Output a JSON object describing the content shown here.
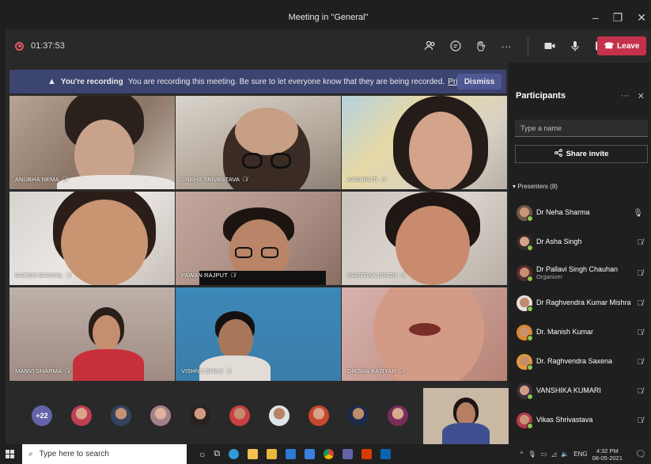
{
  "window": {
    "title": "Meeting in \"General\""
  },
  "toolbar": {
    "timer": "01:37:53",
    "leave_label": "Leave"
  },
  "banner": {
    "bold": "You're recording",
    "text": "You are recording this meeting. Be sure to let everyone know that they are being recorded.",
    "link": "Privacy policy",
    "dismiss": "Dismiss"
  },
  "tiles": [
    {
      "name": "ANUBHA NEMA"
    },
    {
      "name": "SNEHA SRIVASTAVA"
    },
    {
      "name": "AASHRUTI"
    },
    {
      "name": "SAKSHI BANSAL"
    },
    {
      "name": "PAWAN RAJPUT"
    },
    {
      "name": "AVANTIKA SINGH"
    },
    {
      "name": "MANVI SHARMA"
    },
    {
      "name": "VISHNU SHAJI"
    },
    {
      "name": "DIKSHA KATIYAR",
      "more": "···"
    }
  ],
  "strip": {
    "overflow_count": "+22"
  },
  "panel": {
    "title": "Participants",
    "search_placeholder": "Type a name",
    "share_label": "Share invite",
    "presenters_label": "Presenters (8)",
    "people": [
      {
        "name": "Dr Neha Sharma",
        "sub": "",
        "mic": "on"
      },
      {
        "name": "Dr Asha Singh",
        "sub": "",
        "mic": "muted"
      },
      {
        "name": "Dr Pallavi Singh Chauhan",
        "sub": "Organizer",
        "mic": "muted"
      },
      {
        "name": "Dr Raghvendra Kumar Mishra",
        "sub": "",
        "mic": "muted"
      },
      {
        "name": "Dr. Manish Kumar",
        "sub": "",
        "mic": "muted"
      },
      {
        "name": "Dr. Raghvendra Saxena",
        "sub": "",
        "mic": "muted"
      },
      {
        "name": "VANSHIKA KUMARI",
        "sub": "",
        "mic": "muted"
      },
      {
        "name": "Vikas Shrivastava",
        "sub": "",
        "mic": "muted"
      }
    ]
  },
  "taskbar": {
    "search_placeholder": "Type here to search",
    "lang": "ENG",
    "time": "4:32 PM",
    "date": "08-05-2021"
  }
}
